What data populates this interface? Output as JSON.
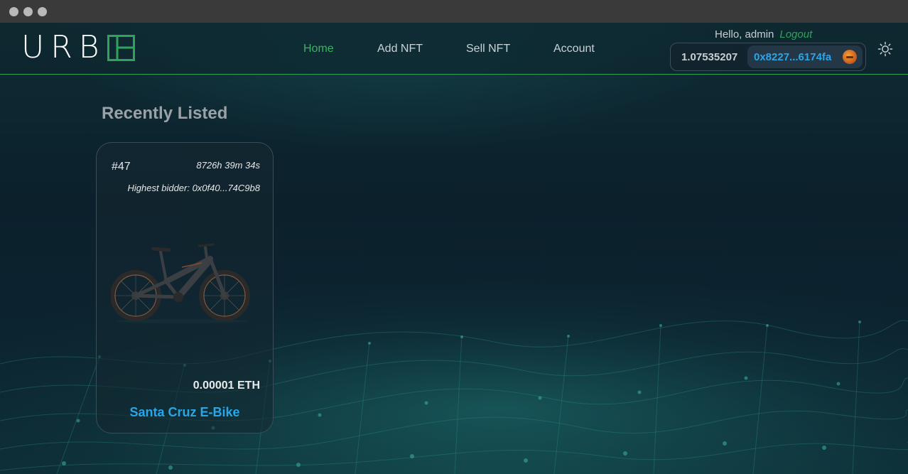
{
  "brand": {
    "logo_text": "URB"
  },
  "nav": {
    "items": [
      {
        "label": "Home",
        "active": true
      },
      {
        "label": "Add NFT",
        "active": false
      },
      {
        "label": "Sell NFT",
        "active": false
      },
      {
        "label": "Account",
        "active": false
      }
    ]
  },
  "user": {
    "greeting": "Hello, admin",
    "logout_label": "Logout"
  },
  "wallet": {
    "balance": "1.07535207",
    "address": "0x8227...6174fa"
  },
  "page": {
    "section_title": "Recently Listed"
  },
  "listings": [
    {
      "id": "#47",
      "time_left": "8726h 39m 34s",
      "highest_bidder": "Highest bidder: 0x0f40...74C9b8",
      "price": "0.00001 ETH",
      "name": "Santa Cruz E-Bike"
    }
  ],
  "colors": {
    "accent_green": "#2fa35a",
    "link_blue": "#2aa6e8",
    "background": "#0b1a24"
  },
  "icons": [
    "sun-icon",
    "avatar-icon"
  ]
}
